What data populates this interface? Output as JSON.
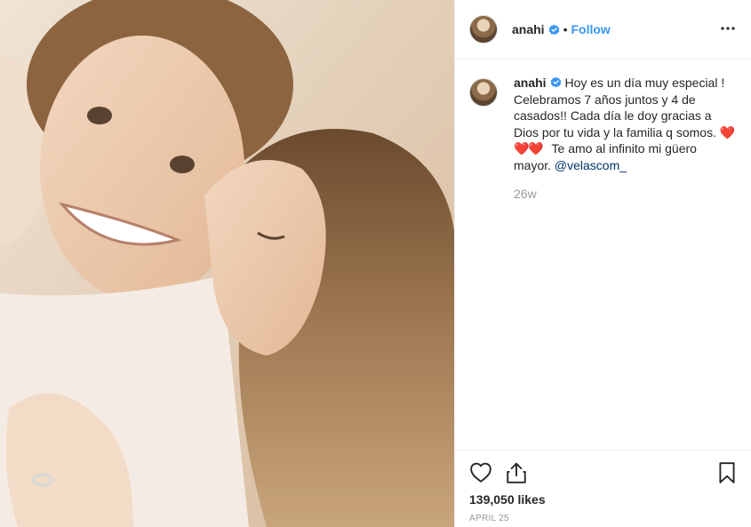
{
  "post": {
    "username": "anahi",
    "dot": "•",
    "follow_label": "Follow",
    "caption_text_1": "Hoy es un día muy especial ! Celebramos 7 años juntos y 4 de casados!! Cada día le doy gracias a Dios por tu vida y la familia q somos.",
    "hearts": "❤️❤️❤️",
    "caption_text_2": " Te amo al infinito mi güero mayor. ",
    "mention": "@velascom_",
    "time_ago": "26w",
    "likes": "139,050 likes",
    "date": "APRIL 25"
  },
  "icons": {
    "verified": "verified-badge-icon",
    "more": "more-options-icon",
    "like": "heart-outline-icon",
    "share": "share-icon",
    "save": "bookmark-icon"
  },
  "colors": {
    "accent": "#3897f0",
    "text": "#262626",
    "muted": "#999999",
    "border": "#efefef"
  }
}
